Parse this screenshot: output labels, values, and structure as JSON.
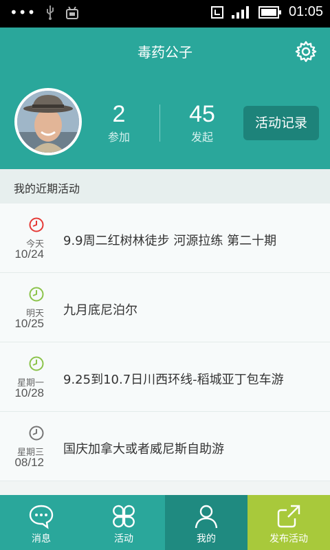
{
  "status": {
    "time": "01:05"
  },
  "header": {
    "title": "毒药公子"
  },
  "stats": [
    {
      "num": "2",
      "label": "参加"
    },
    {
      "num": "45",
      "label": "发起"
    }
  ],
  "record_button": "活动记录",
  "section_title": "我的近期活动",
  "activities": [
    {
      "day": "今天",
      "date": "10/24",
      "name": "9.9周二红树林徒步 河源拉练 第二十期",
      "clock_color": "#e53935"
    },
    {
      "day": "明天",
      "date": "10/25",
      "name": "九月底尼泊尔",
      "clock_color": "#8bc34a"
    },
    {
      "day": "星期一",
      "date": "10/28",
      "name": "9.25到10.7日川西环线-稻城亚丁包车游",
      "clock_color": "#8bc34a"
    },
    {
      "day": "星期三",
      "date": "08/12",
      "name": "国庆加拿大或者威尼斯自助游",
      "clock_color": "#757575"
    }
  ],
  "tabs": [
    {
      "label": "消息",
      "icon": "chat-bubble-icon"
    },
    {
      "label": "活动",
      "icon": "clover-icon"
    },
    {
      "label": "我的",
      "icon": "person-icon"
    },
    {
      "label": "发布活动",
      "icon": "share-out-icon"
    }
  ]
}
